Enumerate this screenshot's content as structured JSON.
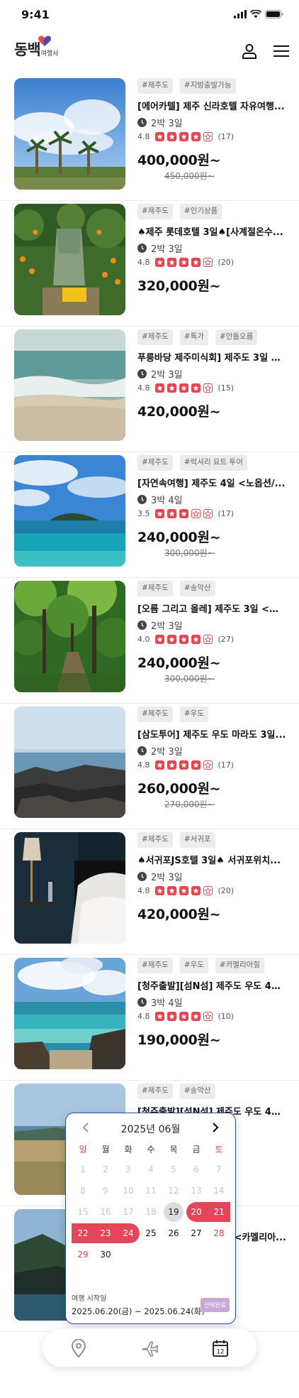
{
  "status": {
    "time": "9:41"
  },
  "header": {
    "logo_main": "동백",
    "logo_sub": "여행사"
  },
  "products": [
    {
      "tags": [
        "#제주도",
        "#지방출발가능"
      ],
      "title": "[에어카텔] 제주 신라호텔 자유여행...",
      "duration": "2박 3일",
      "rating": "4.8",
      "stars": 4,
      "reviews": "(17)",
      "price": "400,000원~",
      "original": "450,000원~"
    },
    {
      "tags": [
        "#제주도",
        "#인기상품"
      ],
      "title": "♠제주 롯데호텔 3일♠[사계절온수...",
      "duration": "2박 3일",
      "rating": "4.8",
      "stars": 4,
      "reviews": "(20)",
      "price": "320,000원~",
      "original": ""
    },
    {
      "tags": [
        "#제주도",
        "#특가",
        "#안돌오름"
      ],
      "title": "푸릉바당 제주미식회] 제주도 3일 <...",
      "duration": "2박 3일",
      "rating": "4.8",
      "stars": 4,
      "reviews": "(15)",
      "price": "420,000원~",
      "original": ""
    },
    {
      "tags": [
        "#제주도",
        "#럭셔리 요트 투어"
      ],
      "title": "[자연속여행] 제주도 4일 <노옵션/...",
      "duration": "3박 4일",
      "rating": "3.5",
      "stars": 3,
      "reviews": "(17)",
      "price": "240,000원~",
      "original": "300,000원~"
    },
    {
      "tags": [
        "#제주도",
        "#송악산"
      ],
      "title": "[오름 그리고 올레] 제주도 3일 <카...",
      "duration": "2박 3일",
      "rating": "4.0",
      "stars": 4,
      "reviews": "(27)",
      "price": "240,000원~",
      "original": "300,000원~"
    },
    {
      "tags": [
        "#제주도",
        "#우도"
      ],
      "title": "[삼도투어] 제주도 우도 마라도 3일...",
      "duration": "2박 3일",
      "rating": "4.8",
      "stars": 4,
      "reviews": "(17)",
      "price": "260,000원~",
      "original": "270,000원~"
    },
    {
      "tags": [
        "#제주도",
        "#서귀포"
      ],
      "title": "♠서귀포JS호텔 3일♠ 서귀포위치...",
      "duration": "2박 3일",
      "rating": "4.8",
      "stars": 4,
      "reviews": "(20)",
      "price": "420,000원~",
      "original": ""
    },
    {
      "tags": [
        "#제주도",
        "#우도",
        "#카멜리아힐"
      ],
      "title": "[청주출발][섬N섬] 제주도 우도 4일...",
      "duration": "3박 4일",
      "rating": "4.8",
      "stars": 4,
      "reviews": "(10)",
      "price": "190,000원~",
      "original": ""
    },
    {
      "tags": [
        "#제주도",
        "#송악산"
      ],
      "title": "[청주출발][섬N섬] 제주도 우도 4일...",
      "duration": "",
      "rating": "",
      "stars": 0,
      "reviews": "",
      "price": "",
      "original": ""
    },
    {
      "tags": [],
      "title": "<카멜리아...",
      "duration": "",
      "rating": "",
      "stars": 0,
      "reviews": "",
      "price": "",
      "original": ""
    }
  ],
  "calendar": {
    "title": "2025년 06월",
    "weekdays": [
      "일",
      "월",
      "화",
      "수",
      "목",
      "금",
      "토"
    ],
    "weeks": [
      [
        "1",
        "2",
        "3",
        "4",
        "5",
        "6",
        "7"
      ],
      [
        "8",
        "9",
        "10",
        "11",
        "12",
        "13",
        "14"
      ],
      [
        "15",
        "16",
        "17",
        "18",
        "19",
        "20",
        "21"
      ],
      [
        "22",
        "23",
        "24",
        "25",
        "26",
        "27",
        "28"
      ],
      [
        "29",
        "30",
        "",
        "",
        "",
        "",
        ""
      ]
    ],
    "today": "19",
    "range_start": "20",
    "range_end": "24",
    "start_label": "여행 시작일",
    "range_text": "2025.06.20(금) ~ 2025.06.24(화)",
    "confirm_label": "선택완료"
  },
  "nav": {
    "calendar_day": "12"
  },
  "colors": {
    "accent": "#e5455b",
    "calendar_border": "#2b4aa0",
    "confirm": "#c9a7d6"
  }
}
